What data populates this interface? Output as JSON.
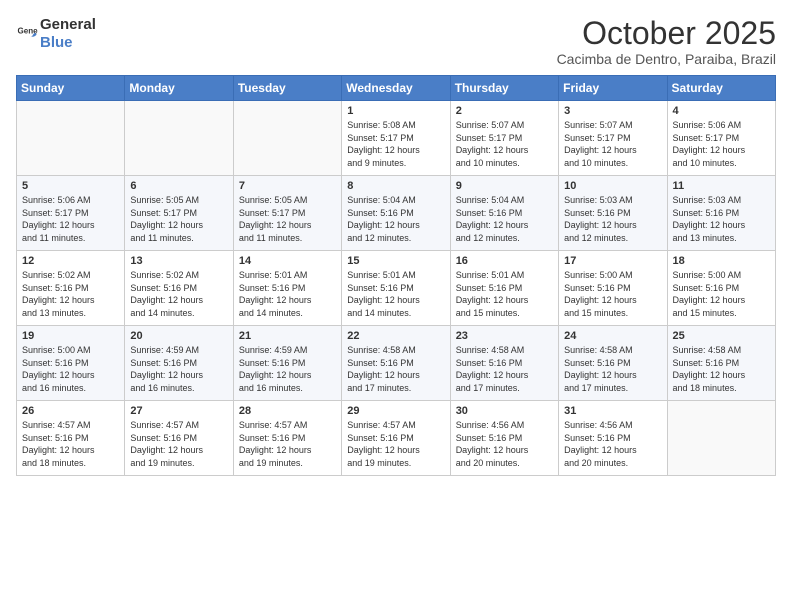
{
  "header": {
    "logo_general": "General",
    "logo_blue": "Blue",
    "month": "October 2025",
    "location": "Cacimba de Dentro, Paraiba, Brazil"
  },
  "weekdays": [
    "Sunday",
    "Monday",
    "Tuesday",
    "Wednesday",
    "Thursday",
    "Friday",
    "Saturday"
  ],
  "weeks": [
    [
      {
        "day": "",
        "info": ""
      },
      {
        "day": "",
        "info": ""
      },
      {
        "day": "",
        "info": ""
      },
      {
        "day": "1",
        "info": "Sunrise: 5:08 AM\nSunset: 5:17 PM\nDaylight: 12 hours\nand 9 minutes."
      },
      {
        "day": "2",
        "info": "Sunrise: 5:07 AM\nSunset: 5:17 PM\nDaylight: 12 hours\nand 10 minutes."
      },
      {
        "day": "3",
        "info": "Sunrise: 5:07 AM\nSunset: 5:17 PM\nDaylight: 12 hours\nand 10 minutes."
      },
      {
        "day": "4",
        "info": "Sunrise: 5:06 AM\nSunset: 5:17 PM\nDaylight: 12 hours\nand 10 minutes."
      }
    ],
    [
      {
        "day": "5",
        "info": "Sunrise: 5:06 AM\nSunset: 5:17 PM\nDaylight: 12 hours\nand 11 minutes."
      },
      {
        "day": "6",
        "info": "Sunrise: 5:05 AM\nSunset: 5:17 PM\nDaylight: 12 hours\nand 11 minutes."
      },
      {
        "day": "7",
        "info": "Sunrise: 5:05 AM\nSunset: 5:17 PM\nDaylight: 12 hours\nand 11 minutes."
      },
      {
        "day": "8",
        "info": "Sunrise: 5:04 AM\nSunset: 5:16 PM\nDaylight: 12 hours\nand 12 minutes."
      },
      {
        "day": "9",
        "info": "Sunrise: 5:04 AM\nSunset: 5:16 PM\nDaylight: 12 hours\nand 12 minutes."
      },
      {
        "day": "10",
        "info": "Sunrise: 5:03 AM\nSunset: 5:16 PM\nDaylight: 12 hours\nand 12 minutes."
      },
      {
        "day": "11",
        "info": "Sunrise: 5:03 AM\nSunset: 5:16 PM\nDaylight: 12 hours\nand 13 minutes."
      }
    ],
    [
      {
        "day": "12",
        "info": "Sunrise: 5:02 AM\nSunset: 5:16 PM\nDaylight: 12 hours\nand 13 minutes."
      },
      {
        "day": "13",
        "info": "Sunrise: 5:02 AM\nSunset: 5:16 PM\nDaylight: 12 hours\nand 14 minutes."
      },
      {
        "day": "14",
        "info": "Sunrise: 5:01 AM\nSunset: 5:16 PM\nDaylight: 12 hours\nand 14 minutes."
      },
      {
        "day": "15",
        "info": "Sunrise: 5:01 AM\nSunset: 5:16 PM\nDaylight: 12 hours\nand 14 minutes."
      },
      {
        "day": "16",
        "info": "Sunrise: 5:01 AM\nSunset: 5:16 PM\nDaylight: 12 hours\nand 15 minutes."
      },
      {
        "day": "17",
        "info": "Sunrise: 5:00 AM\nSunset: 5:16 PM\nDaylight: 12 hours\nand 15 minutes."
      },
      {
        "day": "18",
        "info": "Sunrise: 5:00 AM\nSunset: 5:16 PM\nDaylight: 12 hours\nand 15 minutes."
      }
    ],
    [
      {
        "day": "19",
        "info": "Sunrise: 5:00 AM\nSunset: 5:16 PM\nDaylight: 12 hours\nand 16 minutes."
      },
      {
        "day": "20",
        "info": "Sunrise: 4:59 AM\nSunset: 5:16 PM\nDaylight: 12 hours\nand 16 minutes."
      },
      {
        "day": "21",
        "info": "Sunrise: 4:59 AM\nSunset: 5:16 PM\nDaylight: 12 hours\nand 16 minutes."
      },
      {
        "day": "22",
        "info": "Sunrise: 4:58 AM\nSunset: 5:16 PM\nDaylight: 12 hours\nand 17 minutes."
      },
      {
        "day": "23",
        "info": "Sunrise: 4:58 AM\nSunset: 5:16 PM\nDaylight: 12 hours\nand 17 minutes."
      },
      {
        "day": "24",
        "info": "Sunrise: 4:58 AM\nSunset: 5:16 PM\nDaylight: 12 hours\nand 17 minutes."
      },
      {
        "day": "25",
        "info": "Sunrise: 4:58 AM\nSunset: 5:16 PM\nDaylight: 12 hours\nand 18 minutes."
      }
    ],
    [
      {
        "day": "26",
        "info": "Sunrise: 4:57 AM\nSunset: 5:16 PM\nDaylight: 12 hours\nand 18 minutes."
      },
      {
        "day": "27",
        "info": "Sunrise: 4:57 AM\nSunset: 5:16 PM\nDaylight: 12 hours\nand 19 minutes."
      },
      {
        "day": "28",
        "info": "Sunrise: 4:57 AM\nSunset: 5:16 PM\nDaylight: 12 hours\nand 19 minutes."
      },
      {
        "day": "29",
        "info": "Sunrise: 4:57 AM\nSunset: 5:16 PM\nDaylight: 12 hours\nand 19 minutes."
      },
      {
        "day": "30",
        "info": "Sunrise: 4:56 AM\nSunset: 5:16 PM\nDaylight: 12 hours\nand 20 minutes."
      },
      {
        "day": "31",
        "info": "Sunrise: 4:56 AM\nSunset: 5:16 PM\nDaylight: 12 hours\nand 20 minutes."
      },
      {
        "day": "",
        "info": ""
      }
    ]
  ]
}
